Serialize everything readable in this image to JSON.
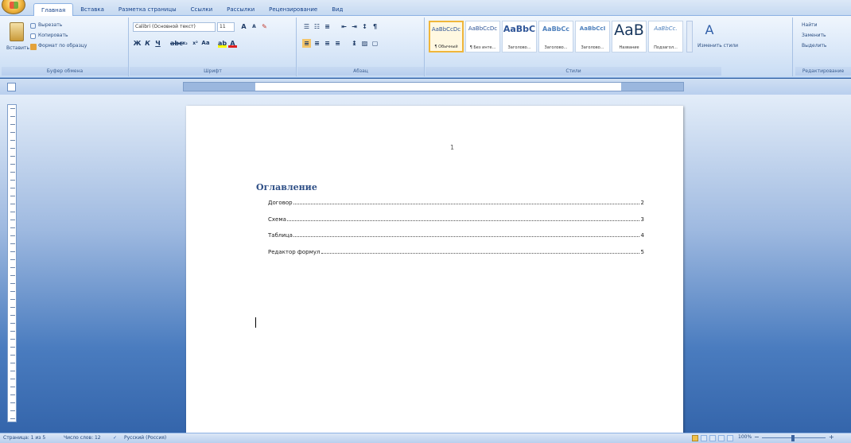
{
  "tabs": [
    "Главная",
    "Вставка",
    "Разметка страницы",
    "Ссылки",
    "Рассылки",
    "Рецензирование",
    "Вид"
  ],
  "ribbon": {
    "clipboard": {
      "paste": "Вставить",
      "cut": "Вырезать",
      "copy": "Копировать",
      "format_painter": "Формат по образцу",
      "label": "Буфер обмена"
    },
    "font": {
      "font_name": "Calibri (Основной текст)",
      "font_size": "11",
      "label": "Шрифт"
    },
    "paragraph": {
      "label": "Абзац"
    },
    "styles": {
      "items": [
        {
          "sample": "AaBbCcDc",
          "name": "¶ Обычный"
        },
        {
          "sample": "AaBbCcDc",
          "name": "¶ Без инте..."
        },
        {
          "sample": "AaBbC",
          "name": "Заголово..."
        },
        {
          "sample": "AaBbCc",
          "name": "Заголово..."
        },
        {
          "sample": "AaBbCcI",
          "name": "Заголово..."
        },
        {
          "sample": "AaB",
          "name": "Название"
        },
        {
          "sample": "AaBbCc.",
          "name": "Подзагол..."
        }
      ],
      "change_styles": "Изменить стили",
      "label": "Стили"
    },
    "editing": {
      "find": "Найти",
      "replace": "Заменить",
      "select": "Выделить",
      "label": "Редактирование"
    }
  },
  "document": {
    "page_number": "1",
    "toc_title": "Оглавление",
    "toc_entries": [
      {
        "text": "Договор",
        "page": "2"
      },
      {
        "text": "Схема",
        "page": "3"
      },
      {
        "text": "Таблица",
        "page": "4"
      },
      {
        "text": "Редактор формул",
        "page": "5"
      }
    ]
  },
  "status": {
    "page": "Страница: 1 из 5",
    "words": "Число слов: 12",
    "language": "Русский (Россия)",
    "zoom": "100%"
  }
}
